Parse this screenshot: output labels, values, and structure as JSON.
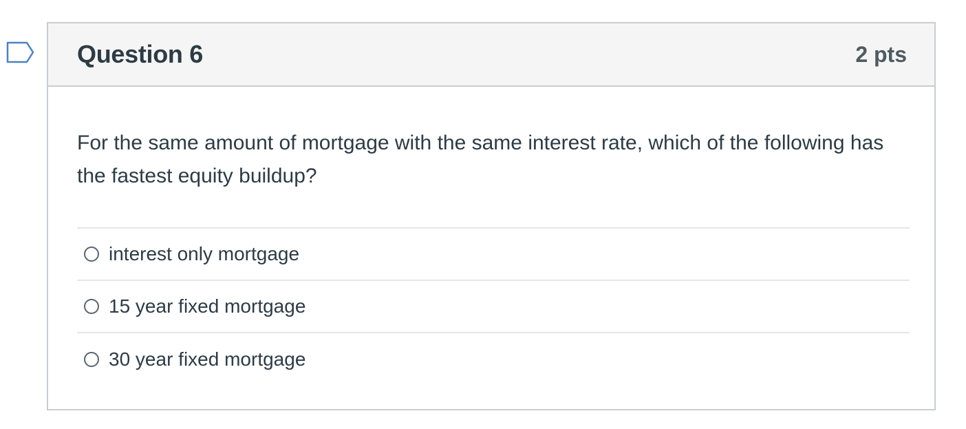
{
  "question": {
    "title": "Question 6",
    "points": "2 pts",
    "text": "For the same amount of mortgage with the same interest rate, which of the following has the fastest equity buildup?",
    "flag_icon": "flag-question-icon",
    "answers": [
      {
        "label": "interest only mortgage",
        "selected": false
      },
      {
        "label": "15 year fixed mortgage",
        "selected": false
      },
      {
        "label": "30 year fixed mortgage",
        "selected": false
      }
    ]
  },
  "colors": {
    "text": "#2d3b45",
    "header_bg": "#f5f5f5",
    "border": "#c7cdd1",
    "divider": "#e3e5e7",
    "flag": "#4f81bd"
  }
}
